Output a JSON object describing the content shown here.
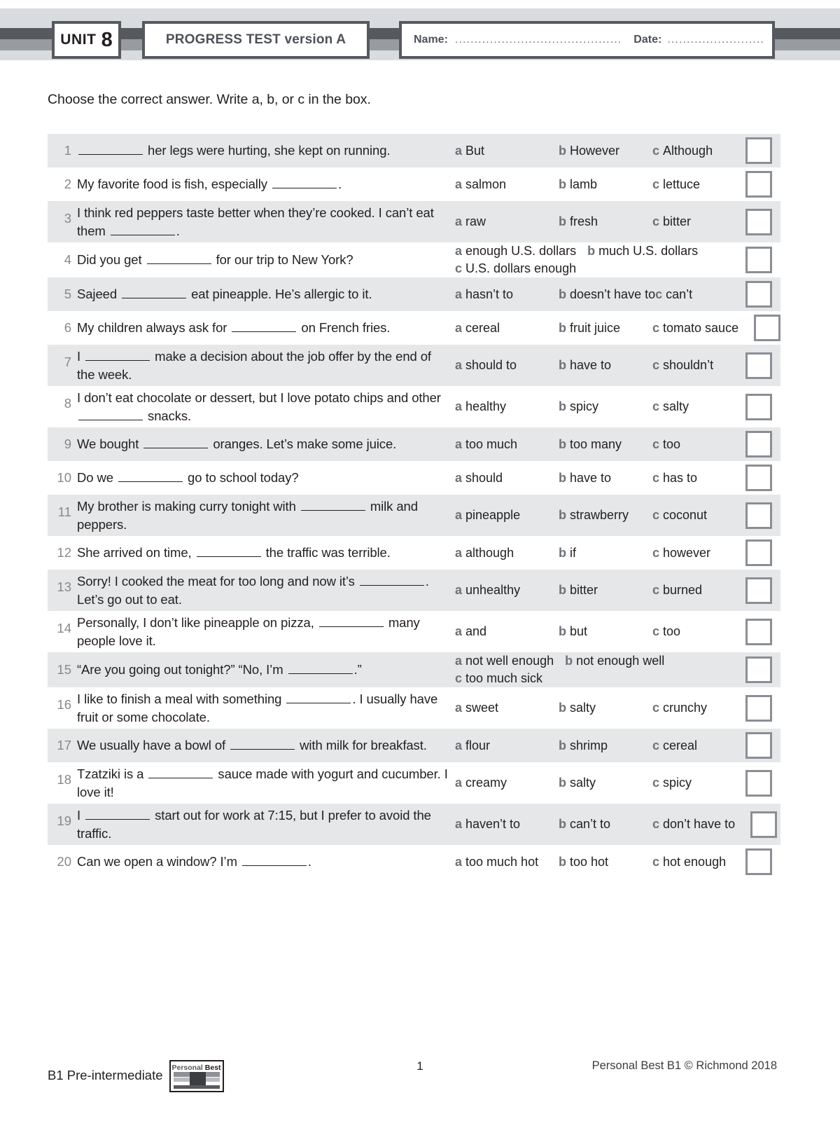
{
  "header": {
    "unit_word": "UNIT",
    "unit_number": "8",
    "test_title": "PROGRESS TEST version A",
    "name_label": "Name:",
    "name_dots": "....................................................................",
    "date_label": "Date:",
    "date_dots": "................................................"
  },
  "instruction": "Choose the correct answer. Write a, b, or c in the box.",
  "option_letters": {
    "a": "a",
    "b": "b",
    "c": "c"
  },
  "questions": [
    {
      "number": "1",
      "text_before": "",
      "text_after": " her legs were hurting, she kept on running.",
      "layout": "inline",
      "lines": 1,
      "a": "But",
      "b": "However",
      "c": "Although"
    },
    {
      "number": "2",
      "text_before": "My favorite food is fish, especially ",
      "text_after": ".",
      "layout": "inline",
      "lines": 1,
      "a": "salmon",
      "b": "lamb",
      "c": "lettuce"
    },
    {
      "number": "3",
      "text_before": "I think red peppers taste better when they’re cooked. I can’t eat them ",
      "text_after": ".",
      "layout": "inline",
      "lines": 2,
      "a": "raw",
      "b": "fresh",
      "c": "bitter"
    },
    {
      "number": "4",
      "text_before": "Did you get ",
      "text_after": " for our trip to New York?",
      "layout": "wrapped",
      "lines": 1,
      "a": "enough U.S. dollars",
      "b": "much U.S. dollars",
      "c": "U.S. dollars enough"
    },
    {
      "number": "5",
      "text_before": "Sajeed ",
      "text_after": " eat pineapple. He’s allergic to it.",
      "layout": "inline",
      "lines": 1,
      "a": "hasn’t to",
      "b": "doesn’t have to",
      "c": "can’t"
    },
    {
      "number": "6",
      "text_before": "My children always ask for ",
      "text_after": " on French fries.",
      "layout": "inline",
      "lines": 1,
      "a": "cereal",
      "b": "fruit juice",
      "c": "tomato sauce"
    },
    {
      "number": "7",
      "text_before": "I ",
      "text_after": " make a decision about the job offer by the end of the week.",
      "layout": "inline",
      "lines": 2,
      "a": "should to",
      "b": "have to",
      "c": "shouldn’t"
    },
    {
      "number": "8",
      "text_before": "I don’t eat chocolate or dessert, but I love potato chips and other ",
      "text_after": " snacks.",
      "layout": "inline",
      "lines": 2,
      "a": "healthy",
      "b": "spicy",
      "c": "salty"
    },
    {
      "number": "9",
      "text_before": "We bought ",
      "text_after": " oranges. Let’s make some juice.",
      "layout": "inline",
      "lines": 1,
      "a": "too much",
      "b": "too many",
      "c": "too"
    },
    {
      "number": "10",
      "text_before": "Do we ",
      "text_after": " go to school today?",
      "layout": "inline",
      "lines": 1,
      "a": "should",
      "b": "have to",
      "c": "has to"
    },
    {
      "number": "11",
      "text_before": "My brother is making curry tonight with ",
      "text_after": " milk and peppers.",
      "layout": "inline",
      "lines": 2,
      "a": "pineapple",
      "b": "strawberry",
      "c": "coconut"
    },
    {
      "number": "12",
      "text_before": "She arrived on time, ",
      "text_after": " the traffic was terrible.",
      "layout": "inline",
      "lines": 1,
      "a": "although",
      "b": "if",
      "c": "however"
    },
    {
      "number": "13",
      "text_before": "Sorry! I cooked the meat for too long and now it’s ",
      "text_after": ". Let’s go out to eat.",
      "layout": "inline",
      "lines": 2,
      "a": "unhealthy",
      "b": "bitter",
      "c": "burned"
    },
    {
      "number": "14",
      "text_before": "Personally, I don’t like pineapple on pizza, ",
      "text_after": " many people love it.",
      "layout": "inline",
      "lines": 2,
      "a": "and",
      "b": "but",
      "c": "too"
    },
    {
      "number": "15",
      "text_before": "“Are you going out tonight?” “No, I’m ",
      "text_after": ".”",
      "layout": "wrapped",
      "lines": 1,
      "a": "not well enough",
      "b": "not enough well",
      "c": "too much sick"
    },
    {
      "number": "16",
      "text_before": "I like to finish a meal with something ",
      "text_after": ". I usually have fruit or some chocolate.",
      "layout": "inline",
      "lines": 2,
      "a": "sweet",
      "b": "salty",
      "c": "crunchy"
    },
    {
      "number": "17",
      "text_before": "We usually have a bowl of ",
      "text_after": " with milk for breakfast.",
      "layout": "inline",
      "lines": 1,
      "a": "flour",
      "b": "shrimp",
      "c": "cereal"
    },
    {
      "number": "18",
      "text_before": "Tzatziki is a ",
      "text_after": " sauce made with yogurt and cucumber. I love it!",
      "layout": "inline",
      "lines": 2,
      "a": "creamy",
      "b": "salty",
      "c": "spicy"
    },
    {
      "number": "19",
      "text_before": "I ",
      "text_after": " start out for work at 7:15, but I prefer to avoid the traffic.",
      "layout": "inline",
      "lines": 2,
      "a": "haven’t to",
      "b": "can’t to",
      "c": "don’t have to"
    },
    {
      "number": "20",
      "text_before": "Can we open a window? I’m ",
      "text_after": ".",
      "layout": "inline",
      "lines": 1,
      "a": "too much hot",
      "b": "too hot",
      "c": "hot enough"
    }
  ],
  "footer": {
    "level": "B1 Pre-intermediate",
    "logo_personal": "Personal",
    "logo_best": "Best",
    "page_number": "1",
    "copyright": "Personal Best B1 © Richmond 2018"
  },
  "colors": {
    "row_shade": "#e5e7e9",
    "header_band": "#d9dcdf",
    "bar_dark": "#56595e",
    "bar_light": "#989ca1",
    "number_gray": "#86898d",
    "box_border": "#8b8f94"
  }
}
